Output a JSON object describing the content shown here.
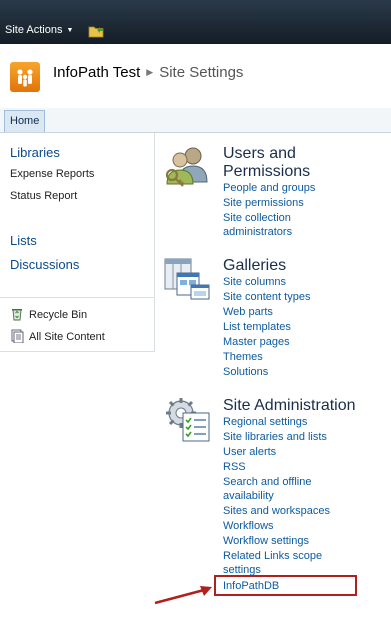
{
  "topbar": {
    "site_actions": "Site Actions"
  },
  "title": {
    "site_name": "InfoPath Test",
    "page_name": "Site Settings"
  },
  "tabs": [
    {
      "label": "Home"
    }
  ],
  "left_nav": {
    "libraries": "Libraries",
    "library_items": [
      "Expense Reports",
      "Status Report"
    ],
    "lists": "Lists",
    "discussions": "Discussions",
    "recycle_bin": "Recycle Bin",
    "all_site_content": "All Site Content"
  },
  "sections": {
    "users": {
      "heading_line1": "Users and",
      "heading_line2": "Permissions",
      "links": [
        "People and groups",
        "Site permissions",
        "Site collection",
        "administrators"
      ]
    },
    "galleries": {
      "heading": "Galleries",
      "links": [
        "Site columns",
        "Site content types",
        "Web parts",
        "List templates",
        "Master pages",
        "Themes",
        "Solutions"
      ]
    },
    "admin": {
      "heading": "Site Administration",
      "links": [
        "Regional settings",
        "Site libraries and lists",
        "User alerts",
        "RSS",
        "Search and offline",
        "availability",
        "Sites and workspaces",
        "Workflows",
        "Workflow settings",
        "Related Links scope",
        "settings",
        "InfoPathDB"
      ]
    }
  },
  "colors": {
    "link": "#0e5ba0",
    "heading": "#1a2e4c",
    "highlight": "#b0201c",
    "logo": "#f09020"
  },
  "icons": [
    "folder-icon",
    "site-logo-icon",
    "users-icon",
    "galleries-icon",
    "site-admin-icon",
    "recycle-bin-icon",
    "all-site-content-icon",
    "arrow-icon"
  ]
}
